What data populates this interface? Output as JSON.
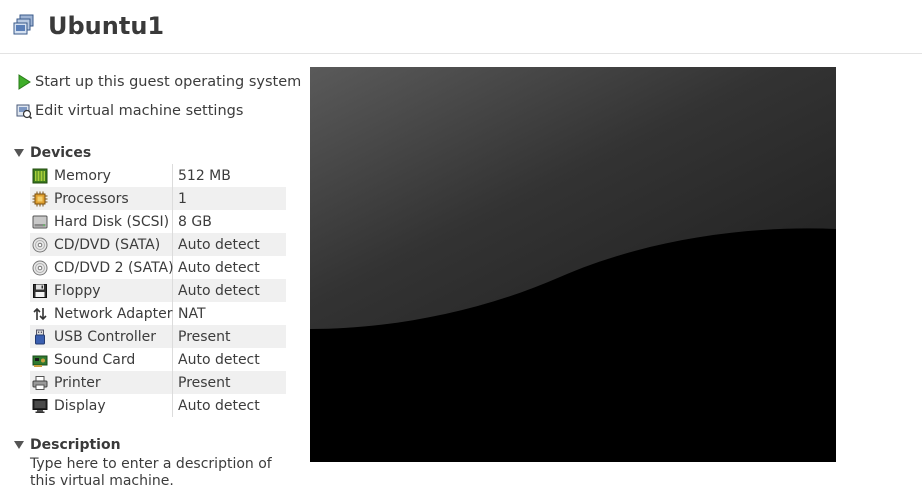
{
  "header": {
    "title": "Ubuntu1",
    "icon": "vm-icon"
  },
  "actions": {
    "start_label": "Start up this guest operating system",
    "edit_label": "Edit virtual machine settings"
  },
  "devices": {
    "heading": "Devices",
    "items": [
      {
        "name": "Memory",
        "value": "512 MB",
        "icon": "memory-icon"
      },
      {
        "name": "Processors",
        "value": "1",
        "icon": "processor-icon"
      },
      {
        "name": "Hard Disk (SCSI)",
        "value": "8 GB",
        "icon": "hard-disk-icon"
      },
      {
        "name": "CD/DVD (SATA)",
        "value": "Auto detect",
        "icon": "cd-dvd-icon"
      },
      {
        "name": "CD/DVD 2 (SATA)",
        "value": "Auto detect",
        "icon": "cd-dvd-icon"
      },
      {
        "name": "Floppy",
        "value": "Auto detect",
        "icon": "floppy-icon"
      },
      {
        "name": "Network Adapter",
        "value": "NAT",
        "icon": "network-adapter-icon"
      },
      {
        "name": "USB Controller",
        "value": "Present",
        "icon": "usb-icon"
      },
      {
        "name": "Sound Card",
        "value": "Auto detect",
        "icon": "sound-card-icon"
      },
      {
        "name": "Printer",
        "value": "Present",
        "icon": "printer-icon"
      },
      {
        "name": "Display",
        "value": "Auto detect",
        "icon": "display-icon"
      }
    ]
  },
  "description": {
    "heading": "Description",
    "placeholder": "Type here to enter a description of this virtual machine."
  },
  "colors": {
    "start_green": "#3fae2a",
    "row_alt": "#f0f0f0",
    "screen_bg": "#000000"
  }
}
